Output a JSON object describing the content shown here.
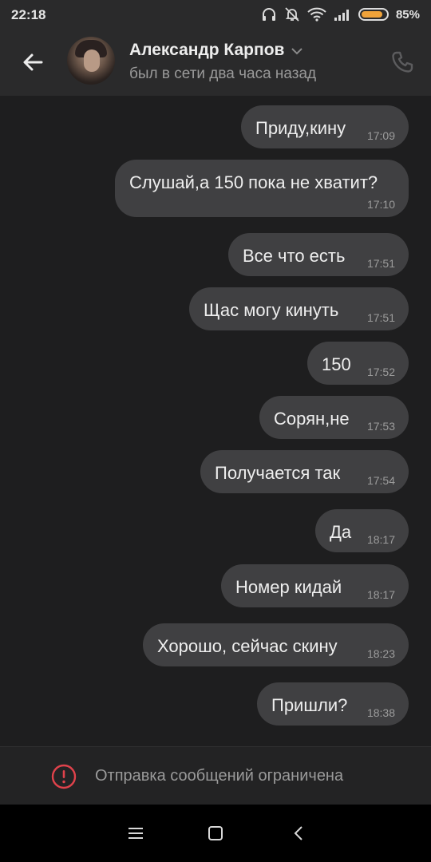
{
  "status_bar": {
    "time": "22:18",
    "battery_percent": "85%",
    "battery_level": 0.85
  },
  "header": {
    "contact_name": "Александр Карпов",
    "last_seen": "был в сети два часа назад"
  },
  "messages": [
    {
      "text": "Приду,кину",
      "time": "17:09"
    },
    {
      "text": "Слушай,а 150 пока не хватит?",
      "time": "17:10"
    },
    {
      "text": "Все что есть",
      "time": "17:51"
    },
    {
      "text": "Щас могу кинуть",
      "time": "17:51"
    },
    {
      "text": "150",
      "time": "17:52"
    },
    {
      "text": "Сорян,не",
      "time": "17:53"
    },
    {
      "text": "Получается так",
      "time": "17:54"
    },
    {
      "text": "Да",
      "time": "18:17"
    },
    {
      "text": "Номер кидай",
      "time": "18:17"
    },
    {
      "text": "Хорошо, сейчас скину",
      "time": "18:23"
    },
    {
      "text": "Пришли?",
      "time": "18:38"
    }
  ],
  "restriction_notice": "Отправка сообщений ограничена",
  "colors": {
    "bubble": "#404042",
    "background": "#1e1e1f",
    "warning": "#e0424b",
    "battery": "#f0a33a"
  }
}
